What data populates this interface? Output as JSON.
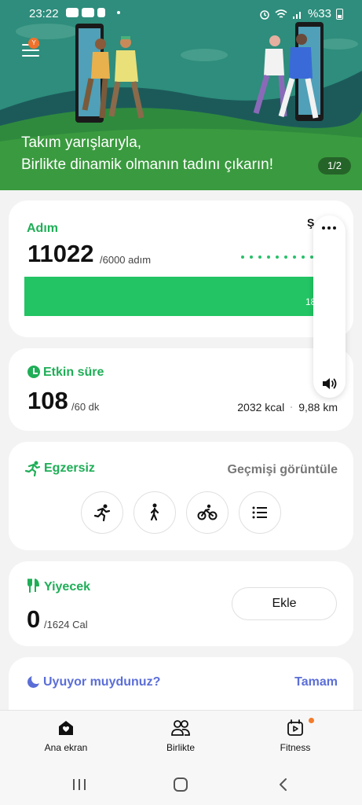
{
  "status_bar": {
    "time": "23:22",
    "battery": "%33"
  },
  "banner": {
    "menu_badge": "Y",
    "line1": "Takım yarışlarıyla,",
    "line2": "Birlikte dinamik olmanın tadını çıkarın!",
    "page_indicator": "1/2"
  },
  "steps": {
    "title": "Adım",
    "value": "11022",
    "goal": "/6000 adım",
    "percent_label": "183",
    "corner_label": "Ş",
    "progress_fraction": 1.0
  },
  "active": {
    "title": "Etkin süre",
    "value": "108",
    "goal": "/60 dk",
    "kcal": "2032 kcal",
    "distance": "9,88 km"
  },
  "exercise": {
    "title": "Egzersiz",
    "history": "Geçmişi görüntüle",
    "buttons": [
      "running-icon",
      "walking-icon",
      "cycling-icon",
      "list-icon"
    ]
  },
  "food": {
    "title": "Yiyecek",
    "value": "0",
    "goal": "/1624 Cal",
    "add_label": "Ekle"
  },
  "sleep": {
    "title": "Uyuyor muydunuz?",
    "action": "Tamam"
  },
  "nav": {
    "items": [
      {
        "label": "Ana ekran",
        "icon": "home-icon"
      },
      {
        "label": "Birlikte",
        "icon": "people-icon"
      },
      {
        "label": "Fitness",
        "icon": "fitness-icon"
      }
    ]
  },
  "colors": {
    "accent_green": "#1fae57",
    "bar_green": "#22c463",
    "sleep_blue": "#5b6ed7",
    "banner_sky": "#2f8f7a",
    "notification": "#f47b2a"
  }
}
